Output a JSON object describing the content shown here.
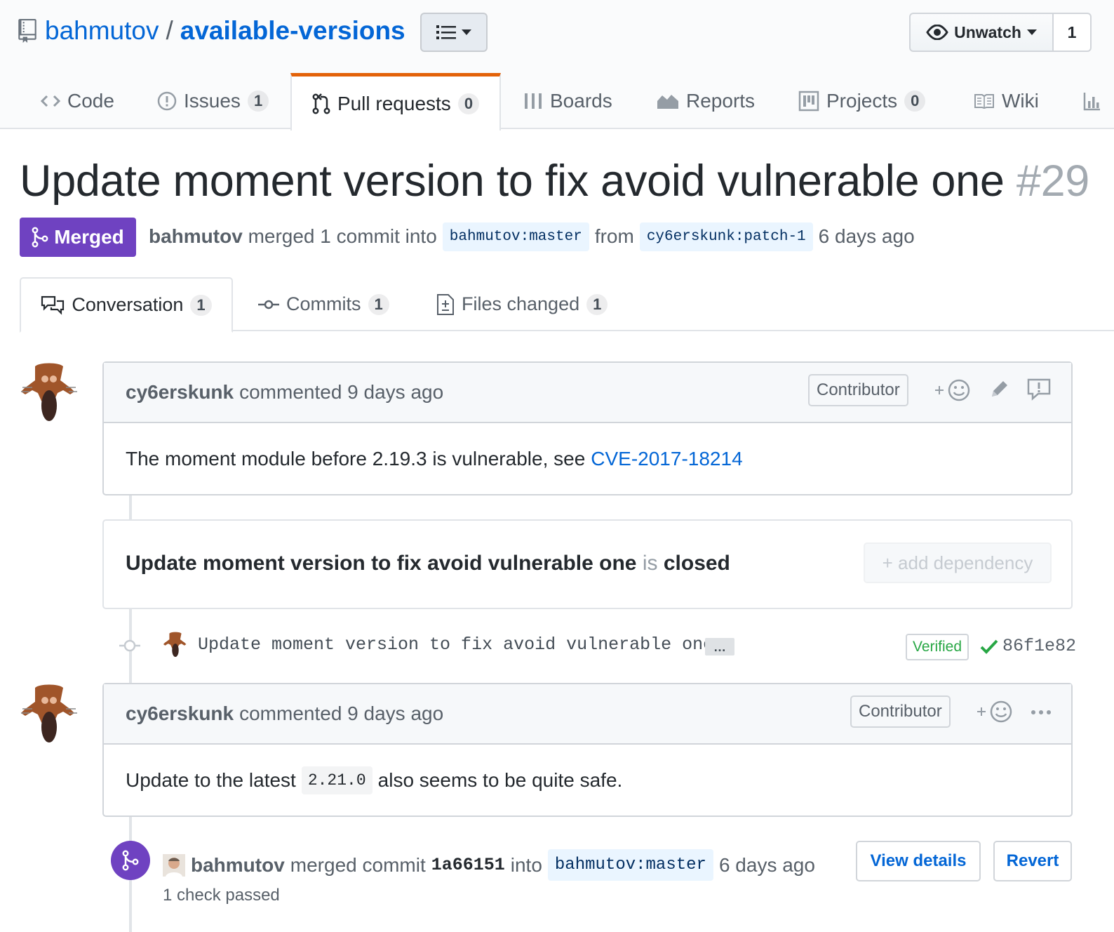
{
  "repo": {
    "owner": "bahmutov",
    "separator": "/",
    "name": "available-versions",
    "watch_label": "Unwatch",
    "watch_count": "1"
  },
  "nav": {
    "tabs": [
      {
        "label": "Code"
      },
      {
        "label": "Issues",
        "count": "1"
      },
      {
        "label": "Pull requests",
        "count": "0",
        "selected": true
      },
      {
        "label": "Boards"
      },
      {
        "label": "Reports"
      },
      {
        "label": "Projects",
        "count": "0"
      },
      {
        "label": "Wiki"
      }
    ]
  },
  "pr": {
    "title": "Update moment version to fix avoid vulnerable one",
    "number": "#29",
    "state": "Merged",
    "meta": {
      "author": "bahmutov",
      "action": "merged 1 commit into",
      "base": "bahmutov:master",
      "from": "from",
      "head": "cy6erskunk:patch-1",
      "time": "6 days ago"
    }
  },
  "pr_tabs": [
    {
      "label": "Conversation",
      "count": "1",
      "selected": true
    },
    {
      "label": "Commits",
      "count": "1"
    },
    {
      "label": "Files changed",
      "count": "1"
    }
  ],
  "comment1": {
    "author": "cy6erskunk",
    "action": "commented 9 days ago",
    "badge": "Contributor",
    "body_text": "The moment module before 2.19.3 is vulnerable, see",
    "body_link": "CVE-2017-18214"
  },
  "dependency": {
    "title": "Update moment version to fix avoid vulnerable one",
    "is": "is",
    "state": "closed",
    "button": "+ add dependency"
  },
  "commit": {
    "message": "Update moment version to fix avoid vulnerable one",
    "ellipsis": "…",
    "verified": "Verified",
    "sha": "86f1e82"
  },
  "comment2": {
    "author": "cy6erskunk",
    "action": "commented 9 days ago",
    "badge": "Contributor",
    "body_before": "Update to the latest",
    "body_code": "2.21.0",
    "body_after": "also seems to be quite safe."
  },
  "merge_event": {
    "author": "bahmutov",
    "action": "merged commit",
    "sha": "1a66151",
    "into": "into",
    "base": "bahmutov:master",
    "time": "6 days ago",
    "checks": "1 check passed",
    "view_details": "View details",
    "revert": "Revert"
  },
  "colors": {
    "link": "#0366d6",
    "merged": "#6f42c1",
    "selected_tab_accent": "#e36209",
    "success": "#28a745"
  }
}
